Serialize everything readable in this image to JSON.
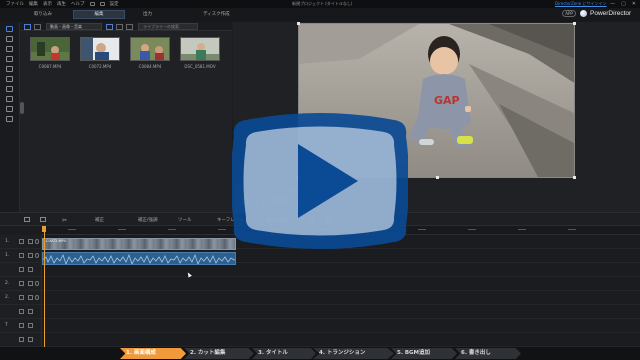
{
  "titlebar": {
    "menus": [
      "ファイル",
      "編集",
      "表示",
      "再生",
      "ヘルプ"
    ],
    "undo_label": "設定",
    "project_title": "新規プロジェクト (タイトルなし)",
    "cyberlink_link": "DirectorZone にサインイン",
    "controls": [
      "—",
      "▢",
      "✕"
    ]
  },
  "modes": {
    "import": "取り込み",
    "edit": "編集",
    "produce": "出力",
    "disc": "ディスク作成"
  },
  "brand": {
    "app_badge": "APP",
    "name": "PowerDirector"
  },
  "library": {
    "filter": "動画・画像・音楽",
    "search_placeholder": "ライブラリーの検索",
    "items": [
      {
        "label": "C0087.MP4"
      },
      {
        "label": "C0072.MP4"
      },
      {
        "label": "C0084.MP4"
      },
      {
        "label": "DSC_0581.MOV"
      }
    ]
  },
  "preview": {
    "timecode": "00;00;00;00"
  },
  "timeline_toolbar": {
    "cut_label": "ソル",
    "fix_label": "補正",
    "fix_enhance_label": "補正/強調",
    "tools_label": "ツール",
    "keyframe_label": "キーフレーム",
    "design_label": "素材の編集"
  },
  "tracks": [
    {
      "num": "1."
    },
    {
      "num": "1."
    },
    {
      "num": ""
    },
    {
      "num": "2."
    },
    {
      "num": "2."
    },
    {
      "num": ""
    },
    {
      "num": "T"
    },
    {
      "num": ""
    }
  ],
  "clip": {
    "name": "C0072.MP4"
  },
  "steps": [
    {
      "label": "1. 画面構成",
      "active": true
    },
    {
      "label": "2. カット編集",
      "active": false
    },
    {
      "label": "3. タイトル",
      "active": false
    },
    {
      "label": "4. トランジション",
      "active": false
    },
    {
      "label": "5. BGM追加",
      "active": false
    },
    {
      "label": "6. 書き出し",
      "active": false
    }
  ],
  "colors": {
    "accent_orange": "#f09a3c",
    "overlay_blue": "#0b4a94",
    "playhead": "#e8a030"
  },
  "icons": {
    "play_overlay": "play-button-icon",
    "search": "search-icon",
    "scissors": "scissors-icon"
  }
}
